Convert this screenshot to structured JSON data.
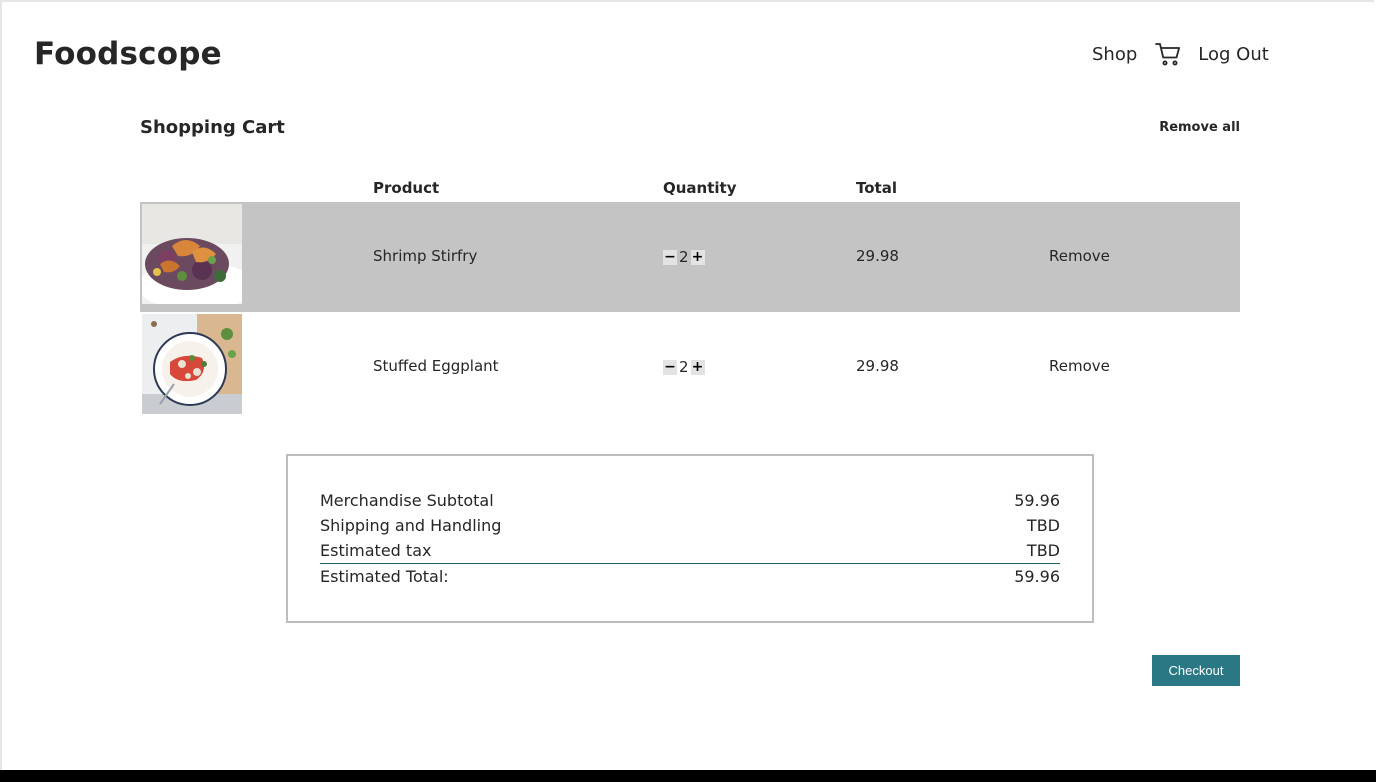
{
  "header": {
    "logo": "Foodscope",
    "nav": {
      "shop": "Shop",
      "logout": "Log Out"
    },
    "cart_icon": "shopping-cart-icon"
  },
  "cart": {
    "title": "Shopping Cart",
    "remove_all": "Remove all",
    "columns": {
      "product": "Product",
      "quantity": "Quantity",
      "total": "Total"
    },
    "items": [
      {
        "name": "Shrimp Stirfry",
        "quantity": "2",
        "total": "29.98",
        "remove": "Remove",
        "minus": "−",
        "plus": "+"
      },
      {
        "name": "Stuffed Eggplant",
        "quantity": "2",
        "total": "29.98",
        "remove": "Remove",
        "minus": "−",
        "plus": "+"
      }
    ]
  },
  "summary": {
    "subtotal_label": "Merchandise Subtotal",
    "subtotal_value": "59.96",
    "shipping_label": "Shipping and Handling",
    "shipping_value": "TBD",
    "tax_label": "Estimated tax",
    "tax_value": "TBD",
    "total_label": "Estimated Total:",
    "total_value": "59.96"
  },
  "checkout_label": "Checkout",
  "colors": {
    "accent": "#2a7883",
    "highlight_row": "#c4c4c4",
    "divider": "#2a5d6c"
  }
}
